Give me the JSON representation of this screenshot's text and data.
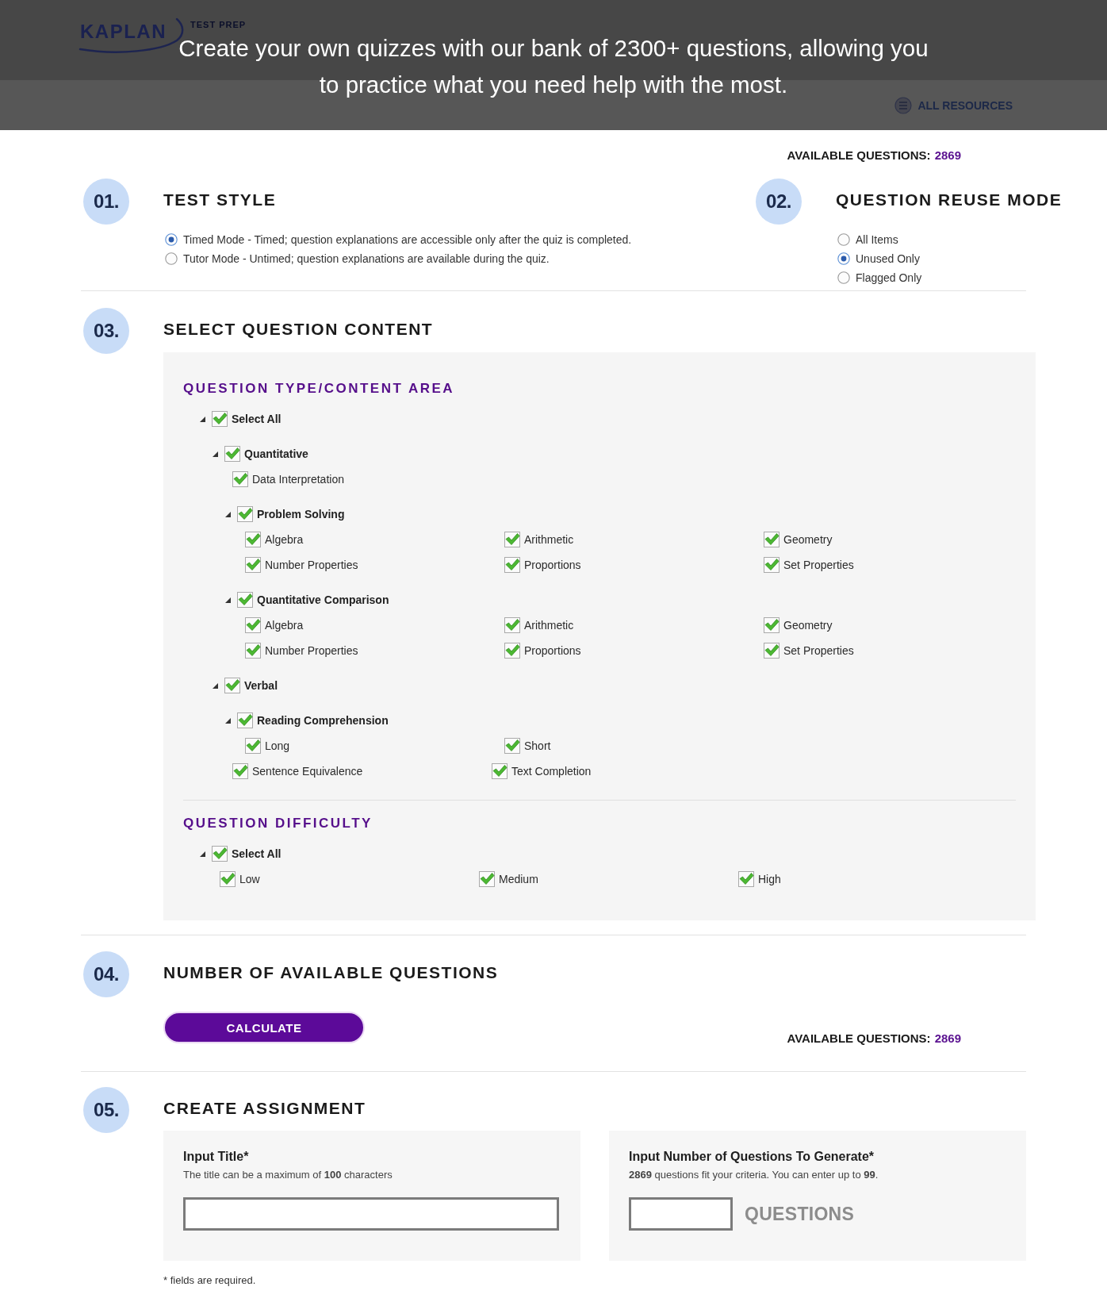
{
  "header": {
    "logo": {
      "wordmark": "KAPLAN",
      "tagline": "TEST PREP"
    },
    "caption": "Create your own quizzes with our bank of 2300+ questions, allowing you to practice what you need help with the most.",
    "resources_link": "ALL RESOURCES"
  },
  "available_top": {
    "label": "AVAILABLE QUESTIONS:",
    "count": "2869"
  },
  "test_style": {
    "number": "01.",
    "title": "TEST STYLE",
    "options": [
      {
        "label": "Timed Mode - Timed; question explanations are accessible only after the quiz is completed.",
        "selected": true
      },
      {
        "label": "Tutor Mode - Untimed; question explanations are available during the quiz.",
        "selected": false
      }
    ]
  },
  "reuse_mode": {
    "number": "02.",
    "title": "QUESTION REUSE MODE",
    "options": [
      {
        "label": "All Items",
        "selected": false
      },
      {
        "label": "Unused Only",
        "selected": true
      },
      {
        "label": "Flagged Only",
        "selected": false
      }
    ]
  },
  "question_content": {
    "number": "03.",
    "title": "SELECT QUESTION CONTENT",
    "groups": [
      {
        "heading": "QUESTION TYPE/CONTENT AREA",
        "tree": [
          {
            "label": "Select All",
            "checked": true,
            "expanded": true,
            "children": [
              {
                "label": "Quantitative",
                "checked": true,
                "expanded": true,
                "children": [
                  {
                    "label": "Data Interpretation",
                    "checked": true
                  },
                  {
                    "label": "Problem Solving",
                    "checked": true,
                    "expanded": true,
                    "children": [
                      {
                        "label": "Algebra",
                        "checked": true
                      },
                      {
                        "label": "Arithmetic",
                        "checked": true
                      },
                      {
                        "label": "Geometry",
                        "checked": true
                      },
                      {
                        "label": "Number Properties",
                        "checked": true
                      },
                      {
                        "label": "Proportions",
                        "checked": true
                      },
                      {
                        "label": "Set Properties",
                        "checked": true
                      }
                    ]
                  },
                  {
                    "label": "Quantitative Comparison",
                    "checked": true,
                    "expanded": true,
                    "children": [
                      {
                        "label": "Algebra",
                        "checked": true
                      },
                      {
                        "label": "Arithmetic",
                        "checked": true
                      },
                      {
                        "label": "Geometry",
                        "checked": true
                      },
                      {
                        "label": "Number Properties",
                        "checked": true
                      },
                      {
                        "label": "Proportions",
                        "checked": true
                      },
                      {
                        "label": "Set Properties",
                        "checked": true
                      }
                    ]
                  }
                ]
              },
              {
                "label": "Verbal",
                "checked": true,
                "expanded": true,
                "children": [
                  {
                    "label": "Reading Comprehension",
                    "checked": true,
                    "expanded": true,
                    "children": [
                      {
                        "label": "Long",
                        "checked": true
                      },
                      {
                        "label": "Short",
                        "checked": true
                      }
                    ]
                  },
                  {
                    "label": "Sentence Equivalence",
                    "checked": true
                  },
                  {
                    "label": "Text Completion",
                    "checked": true
                  }
                ]
              }
            ]
          }
        ]
      },
      {
        "heading": "QUESTION DIFFICULTY",
        "tree": [
          {
            "label": "Select All",
            "checked": true,
            "expanded": true,
            "children": [
              {
                "label": "Low",
                "checked": true
              },
              {
                "label": "Medium",
                "checked": true
              },
              {
                "label": "High",
                "checked": true
              }
            ]
          }
        ]
      }
    ]
  },
  "available_questions": {
    "number": "04.",
    "title": "NUMBER OF AVAILABLE QUESTIONS",
    "button": "CALCULATE",
    "label": "AVAILABLE QUESTIONS:",
    "count": "2869"
  },
  "create_assignment": {
    "number": "05.",
    "title": "CREATE ASSIGNMENT",
    "fields": [
      {
        "kind": "text",
        "label": "Input Title*",
        "hint": "The title can be a maximum of **100** characters"
      },
      {
        "kind": "number",
        "label": "Input Number of Questions To Generate*",
        "hint": "**2869** questions fit your criteria. You can enter up to **99**.",
        "unit": "QUESTIONS"
      }
    ],
    "footnote": "* fields are required."
  }
}
